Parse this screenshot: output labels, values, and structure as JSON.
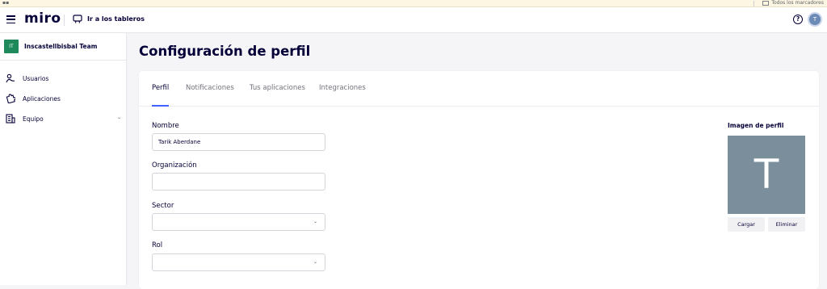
{
  "browser": {
    "apps_icon": "grid-icon",
    "bookmarks_folder": "Todos los marcadores"
  },
  "topbar": {
    "logo": "miro",
    "boards_link": "Ir a los tableros",
    "help": "?",
    "avatar_initial": "T"
  },
  "sidebar": {
    "team": {
      "badge": "IT",
      "name": "Inscastellbisbal Team",
      "badge_color": "#1e8a5c"
    },
    "items": [
      {
        "label": "Usuarios",
        "icon": "users-icon"
      },
      {
        "label": "Aplicaciones",
        "icon": "puzzle-icon"
      },
      {
        "label": "Equipo",
        "icon": "building-icon",
        "expandable": true
      }
    ]
  },
  "main": {
    "title": "Configuración de perfil",
    "tabs": [
      {
        "label": "Perfil",
        "active": true
      },
      {
        "label": "Notificaciones"
      },
      {
        "label": "Tus aplicaciones"
      },
      {
        "label": "Integraciones"
      }
    ],
    "accent_color": "#4262ff",
    "form": {
      "nombre": {
        "label": "Nombre",
        "value": "Tarik Aberdane"
      },
      "organizacion": {
        "label": "Organización",
        "value": ""
      },
      "sector": {
        "label": "Sector",
        "value": ""
      },
      "rol": {
        "label": "Rol",
        "value": ""
      }
    },
    "profile_image": {
      "title": "Imagen de perfil",
      "initial": "T",
      "bg_color": "#7a8f9b",
      "upload_label": "Cargar",
      "delete_label": "Eliminar"
    }
  }
}
